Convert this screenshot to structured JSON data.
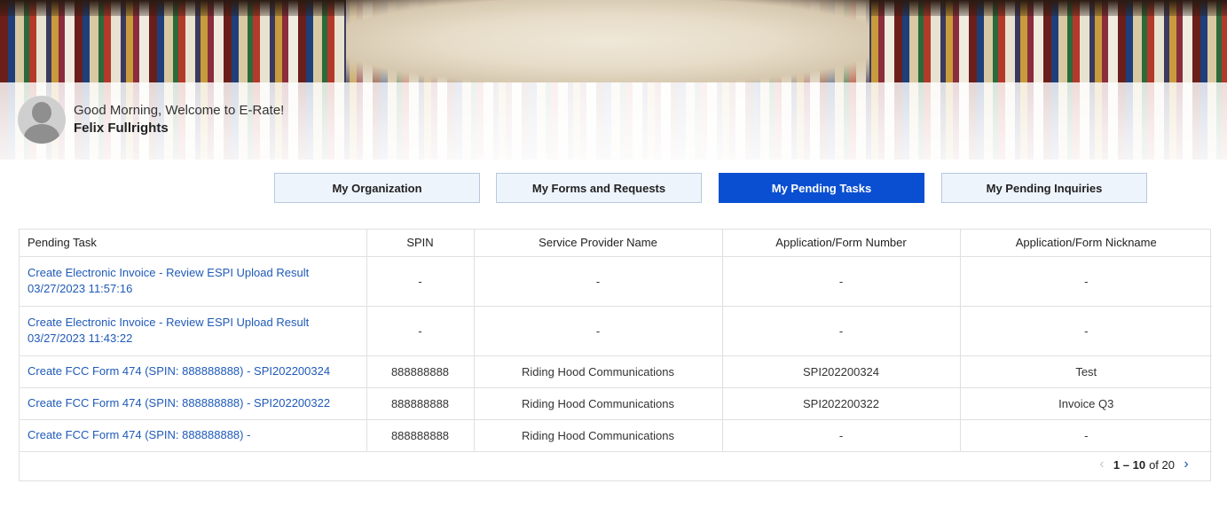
{
  "header": {
    "greeting": "Good Morning, Welcome to E-Rate!",
    "username": "Felix Fullrights"
  },
  "tabs": [
    {
      "label": "My Organization",
      "active": false
    },
    {
      "label": "My Forms and Requests",
      "active": false
    },
    {
      "label": "My Pending Tasks",
      "active": true
    },
    {
      "label": "My Pending Inquiries",
      "active": false
    }
  ],
  "table": {
    "columns": [
      "Pending Task",
      "SPIN",
      "Service Provider Name",
      "Application/Form Number",
      "Application/Form Nickname"
    ],
    "rows": [
      {
        "task_line1": "Create Electronic Invoice - Review ESPI Upload Result",
        "task_line2": "03/27/2023 11:57:16",
        "spin": "-",
        "provider": "-",
        "form_number": "-",
        "nickname": "-"
      },
      {
        "task_line1": "Create Electronic Invoice - Review ESPI Upload Result",
        "task_line2": "03/27/2023 11:43:22",
        "spin": "-",
        "provider": "-",
        "form_number": "-",
        "nickname": "-"
      },
      {
        "task_line1": "Create FCC Form 474 (SPIN: 888888888) - SPI202200324",
        "task_line2": "",
        "spin": "888888888",
        "provider": "Riding Hood Communications",
        "form_number": "SPI202200324",
        "nickname": "Test"
      },
      {
        "task_line1": "Create FCC Form 474 (SPIN: 888888888) - SPI202200322",
        "task_line2": "",
        "spin": "888888888",
        "provider": "Riding Hood Communications",
        "form_number": "SPI202200322",
        "nickname": "Invoice Q3"
      },
      {
        "task_line1": "Create FCC Form 474 (SPIN: 888888888) -",
        "task_line2": "",
        "spin": "888888888",
        "provider": "Riding Hood Communications",
        "form_number": "-",
        "nickname": "-"
      }
    ]
  },
  "pagination": {
    "range": "1 – 10",
    "of_label": "of 20",
    "prev_icon": "chevron-left-icon",
    "next_icon": "chevron-right-icon"
  },
  "colors": {
    "active_tab": "#0a4fd1",
    "inactive_tab": "#eef4fc",
    "link": "#1f5ab8"
  }
}
